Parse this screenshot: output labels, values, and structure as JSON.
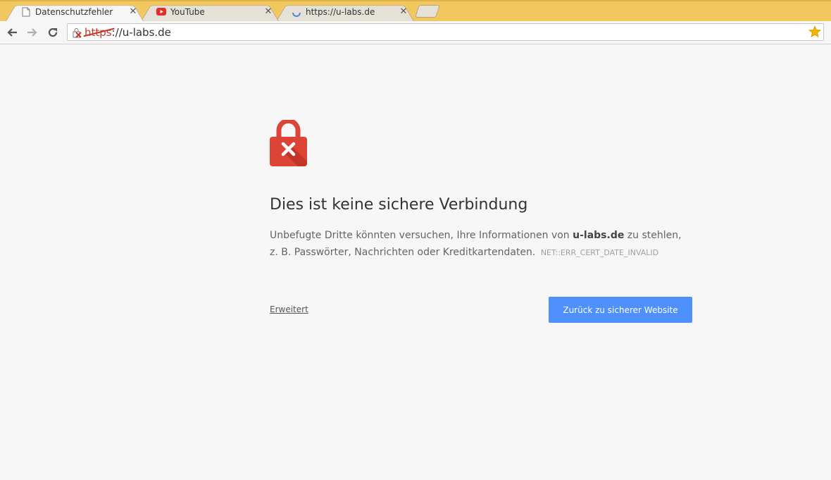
{
  "browser": {
    "tabs": [
      {
        "title": "Datenschutzfehler",
        "icon": "page-icon",
        "active": true
      },
      {
        "title": "YouTube",
        "icon": "youtube-icon",
        "active": false
      },
      {
        "title": "https://u-labs.de",
        "icon": "loading-spinner-icon",
        "active": false
      }
    ],
    "tab_close_glyph": "✕",
    "new_tab_icon": "new-tab-icon",
    "toolbar": {
      "back_icon": "back-arrow-icon",
      "forward_icon": "forward-arrow-icon",
      "reload_icon": "reload-icon",
      "omnibox": {
        "security_icon": "broken-lock-icon",
        "url_scheme": "https",
        "url_rest": "://u-labs.de",
        "bookmark_icon": "star-icon"
      }
    }
  },
  "interstitial": {
    "icon": "red-lock-x-icon",
    "heading": "Dies ist keine sichere Verbindung",
    "desc_part1": "Unbefugte Dritte könnten versuchen, Ihre Informationen von ",
    "desc_host": "u-labs.de",
    "desc_part2": " zu stehlen, z. B. Passwörter, Nachrichten oder Kreditkartendaten.",
    "error_code": "NET::ERR_CERT_DATE_INVALID",
    "advanced_link": "Erweitert",
    "back_button": "Zurück zu sicherer Website"
  },
  "colors": {
    "tabstrip": "#f1c75f",
    "primary_button": "#4d90fe",
    "lock_red": "#db4437",
    "insecure_scheme": "#c53929",
    "star": "#f4b400"
  }
}
